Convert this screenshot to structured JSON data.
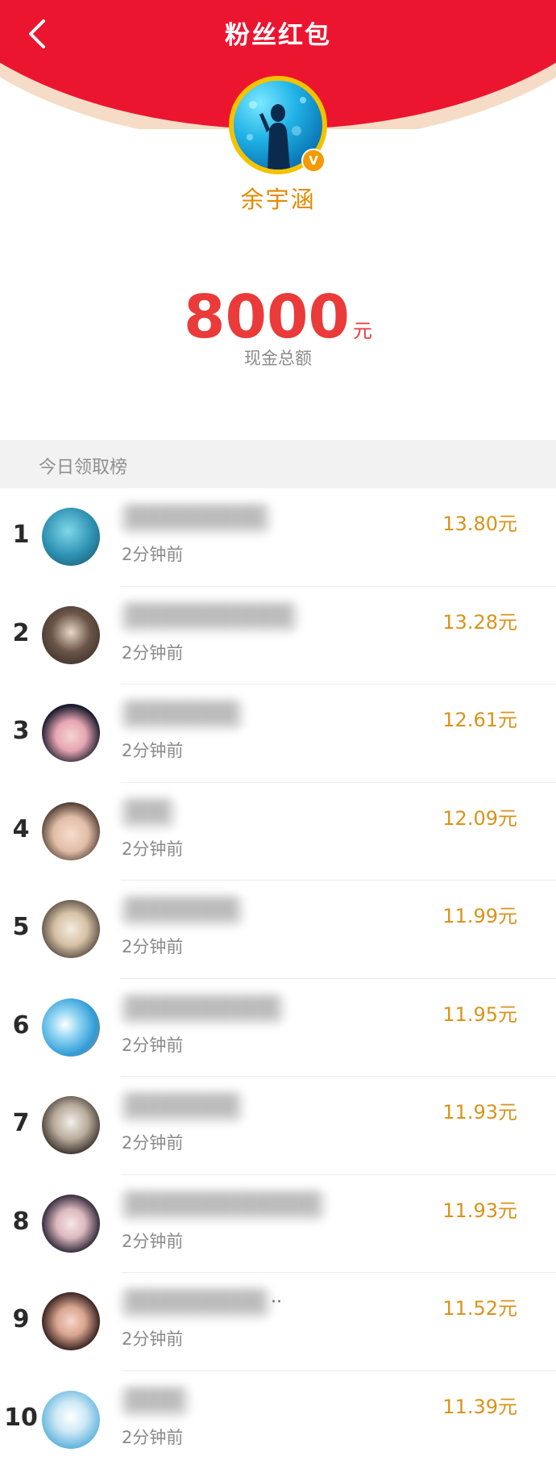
{
  "header": {
    "title": "粉丝红包",
    "back_icon": "chevron-left-icon"
  },
  "profile": {
    "name": "余宇涵",
    "verified_badge": "V",
    "badge_color": "#f39b00"
  },
  "total": {
    "amount": "8000",
    "unit": "元",
    "caption": "现金总额"
  },
  "ranking": {
    "title": "今日领取榜",
    "rows": [
      {
        "rank": "1",
        "name": "██████████",
        "time": "2分钟前",
        "amount": "13.80元"
      },
      {
        "rank": "2",
        "name": "████████████",
        "time": "2分钟前",
        "amount": "13.28元"
      },
      {
        "rank": "3",
        "name": "████████",
        "time": "2分钟前",
        "amount": "12.61元"
      },
      {
        "rank": "4",
        "name": "███",
        "time": "2分钟前",
        "amount": "12.09元"
      },
      {
        "rank": "5",
        "name": "████████",
        "time": "2分钟前",
        "amount": "11.99元"
      },
      {
        "rank": "6",
        "name": "███████████",
        "time": "2分钟前",
        "amount": "11.95元"
      },
      {
        "rank": "7",
        "name": "████████",
        "time": "2分钟前",
        "amount": "11.93元"
      },
      {
        "rank": "8",
        "name": "██████████████",
        "time": "2分钟前",
        "amount": "11.93元"
      },
      {
        "rank": "9",
        "name": "██████████",
        "time": "2分钟前",
        "amount": "11.52元"
      },
      {
        "rank": "10",
        "name": "████",
        "time": "2分钟前",
        "amount": "11.39元"
      }
    ]
  },
  "colors": {
    "header_red": "#ec1530",
    "amount_red": "#ea3a3a",
    "reward_gold": "#d99319",
    "name_orange": "#e58a00"
  }
}
